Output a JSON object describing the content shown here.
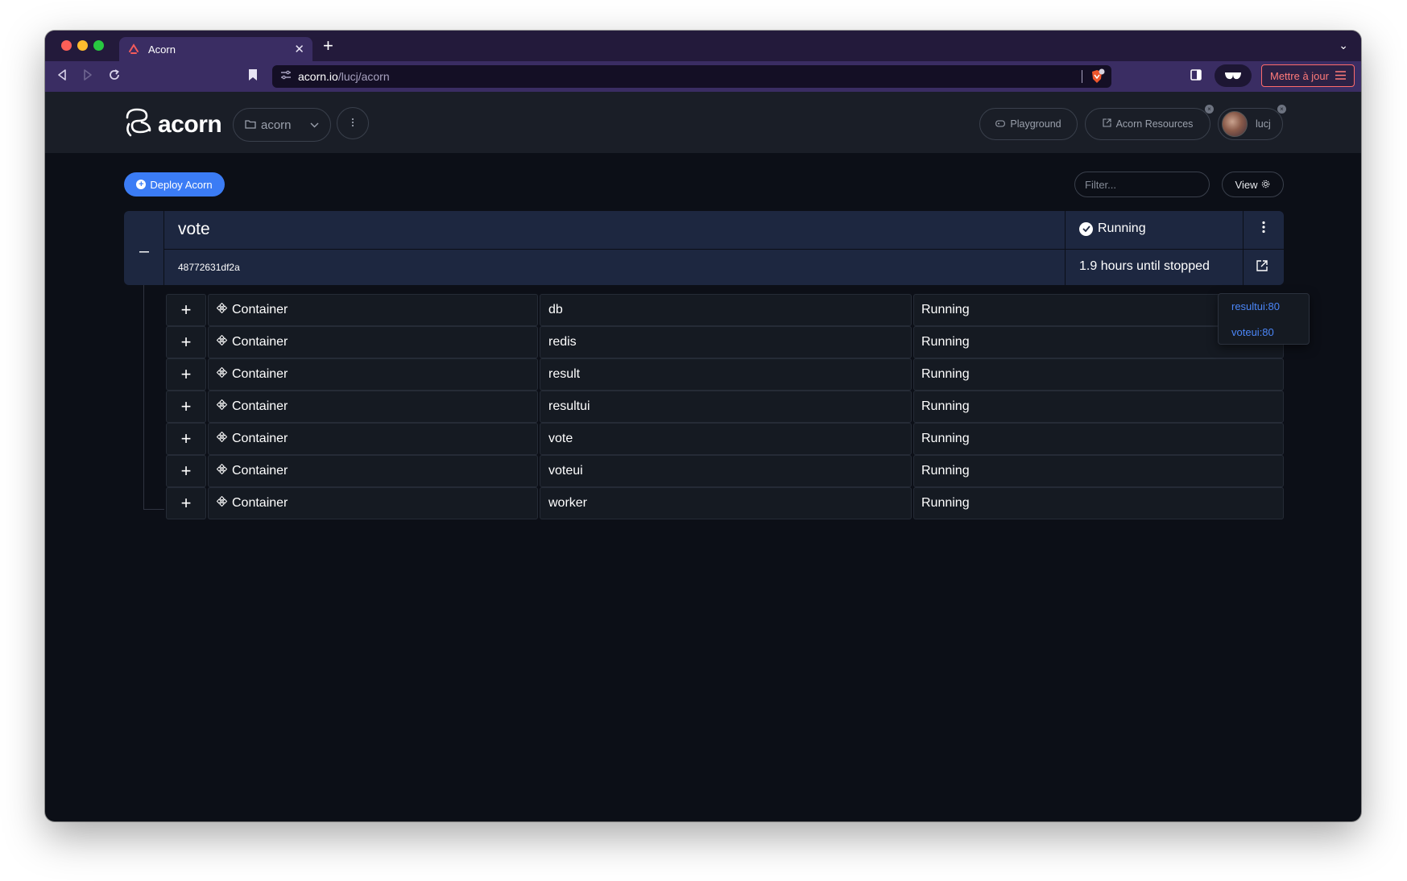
{
  "browser": {
    "tab_title": "Acorn",
    "url_host": "acorn.io",
    "url_path": "/lucj/acorn",
    "update_label": "Mettre à jour",
    "colors": {
      "tabbar": "#231a3b",
      "toolbar": "#3a2d63",
      "update": "#ff6b6b"
    }
  },
  "header": {
    "logo_text": "acorn",
    "project": "acorn",
    "playground_label": "Playground",
    "resources_label": "Acorn Resources",
    "user": "lucj"
  },
  "toolbar": {
    "deploy_label": "Deploy Acorn",
    "filter_placeholder": "Filter...",
    "view_label": "View",
    "accent": "#3b7cf5"
  },
  "app": {
    "name": "vote",
    "id": "48772631df2a",
    "status": "Running",
    "expiry": "1.9 hours until stopped",
    "endpoints": [
      "resultui:80",
      "voteui:80"
    ]
  },
  "containers": [
    {
      "type": "Container",
      "name": "db",
      "status": "Running"
    },
    {
      "type": "Container",
      "name": "redis",
      "status": "Running"
    },
    {
      "type": "Container",
      "name": "result",
      "status": "Running"
    },
    {
      "type": "Container",
      "name": "resultui",
      "status": "Running"
    },
    {
      "type": "Container",
      "name": "vote",
      "status": "Running"
    },
    {
      "type": "Container",
      "name": "voteui",
      "status": "Running"
    },
    {
      "type": "Container",
      "name": "worker",
      "status": "Running"
    }
  ]
}
